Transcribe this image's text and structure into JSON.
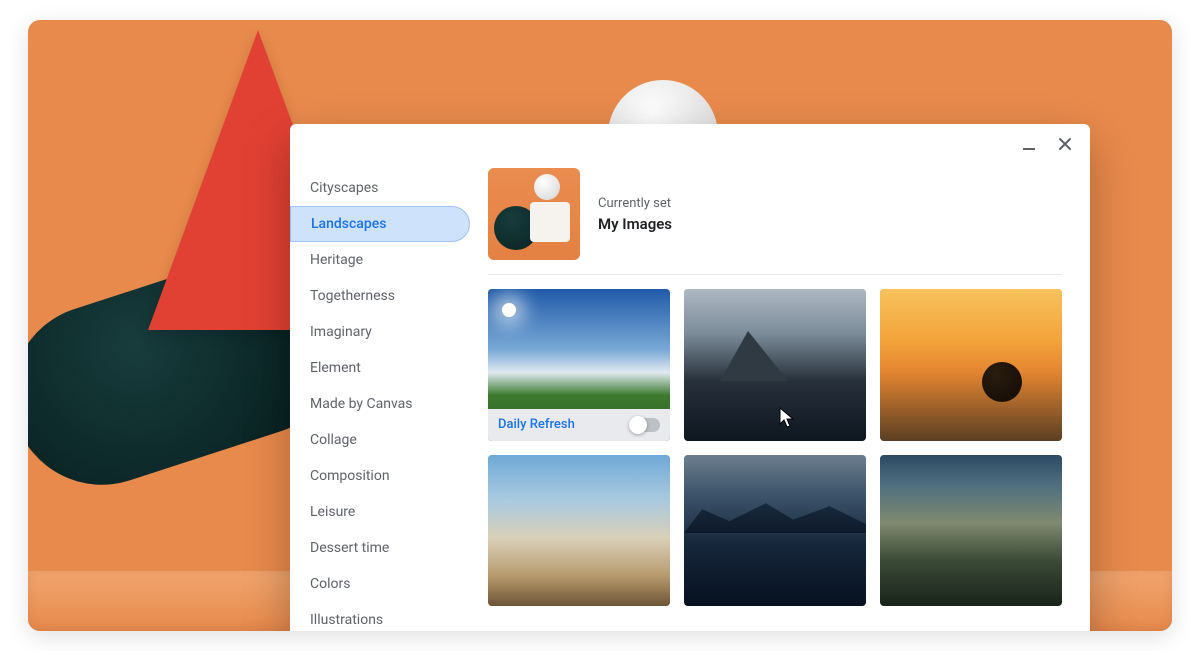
{
  "categories": [
    "Cityscapes",
    "Landscapes",
    "Heritage",
    "Togetherness",
    "Imaginary",
    "Element",
    "Made by Canvas",
    "Collage",
    "Composition",
    "Leisure",
    "Dessert time",
    "Colors",
    "Illustrations"
  ],
  "active_category_index": 1,
  "current": {
    "label": "Currently set",
    "value": "My Images"
  },
  "daily_refresh": {
    "label": "Daily Refresh",
    "enabled": false
  },
  "wallpapers": [
    {
      "name": "landscape-grassland-sky"
    },
    {
      "name": "landscape-mountain-lake"
    },
    {
      "name": "landscape-sunset-beach-rock"
    },
    {
      "name": "landscape-tidal-beach"
    },
    {
      "name": "landscape-dark-mountain-water"
    },
    {
      "name": "landscape-rolling-hills-dusk"
    }
  ],
  "window": {
    "minimize_tooltip": "Minimize",
    "close_tooltip": "Close"
  }
}
